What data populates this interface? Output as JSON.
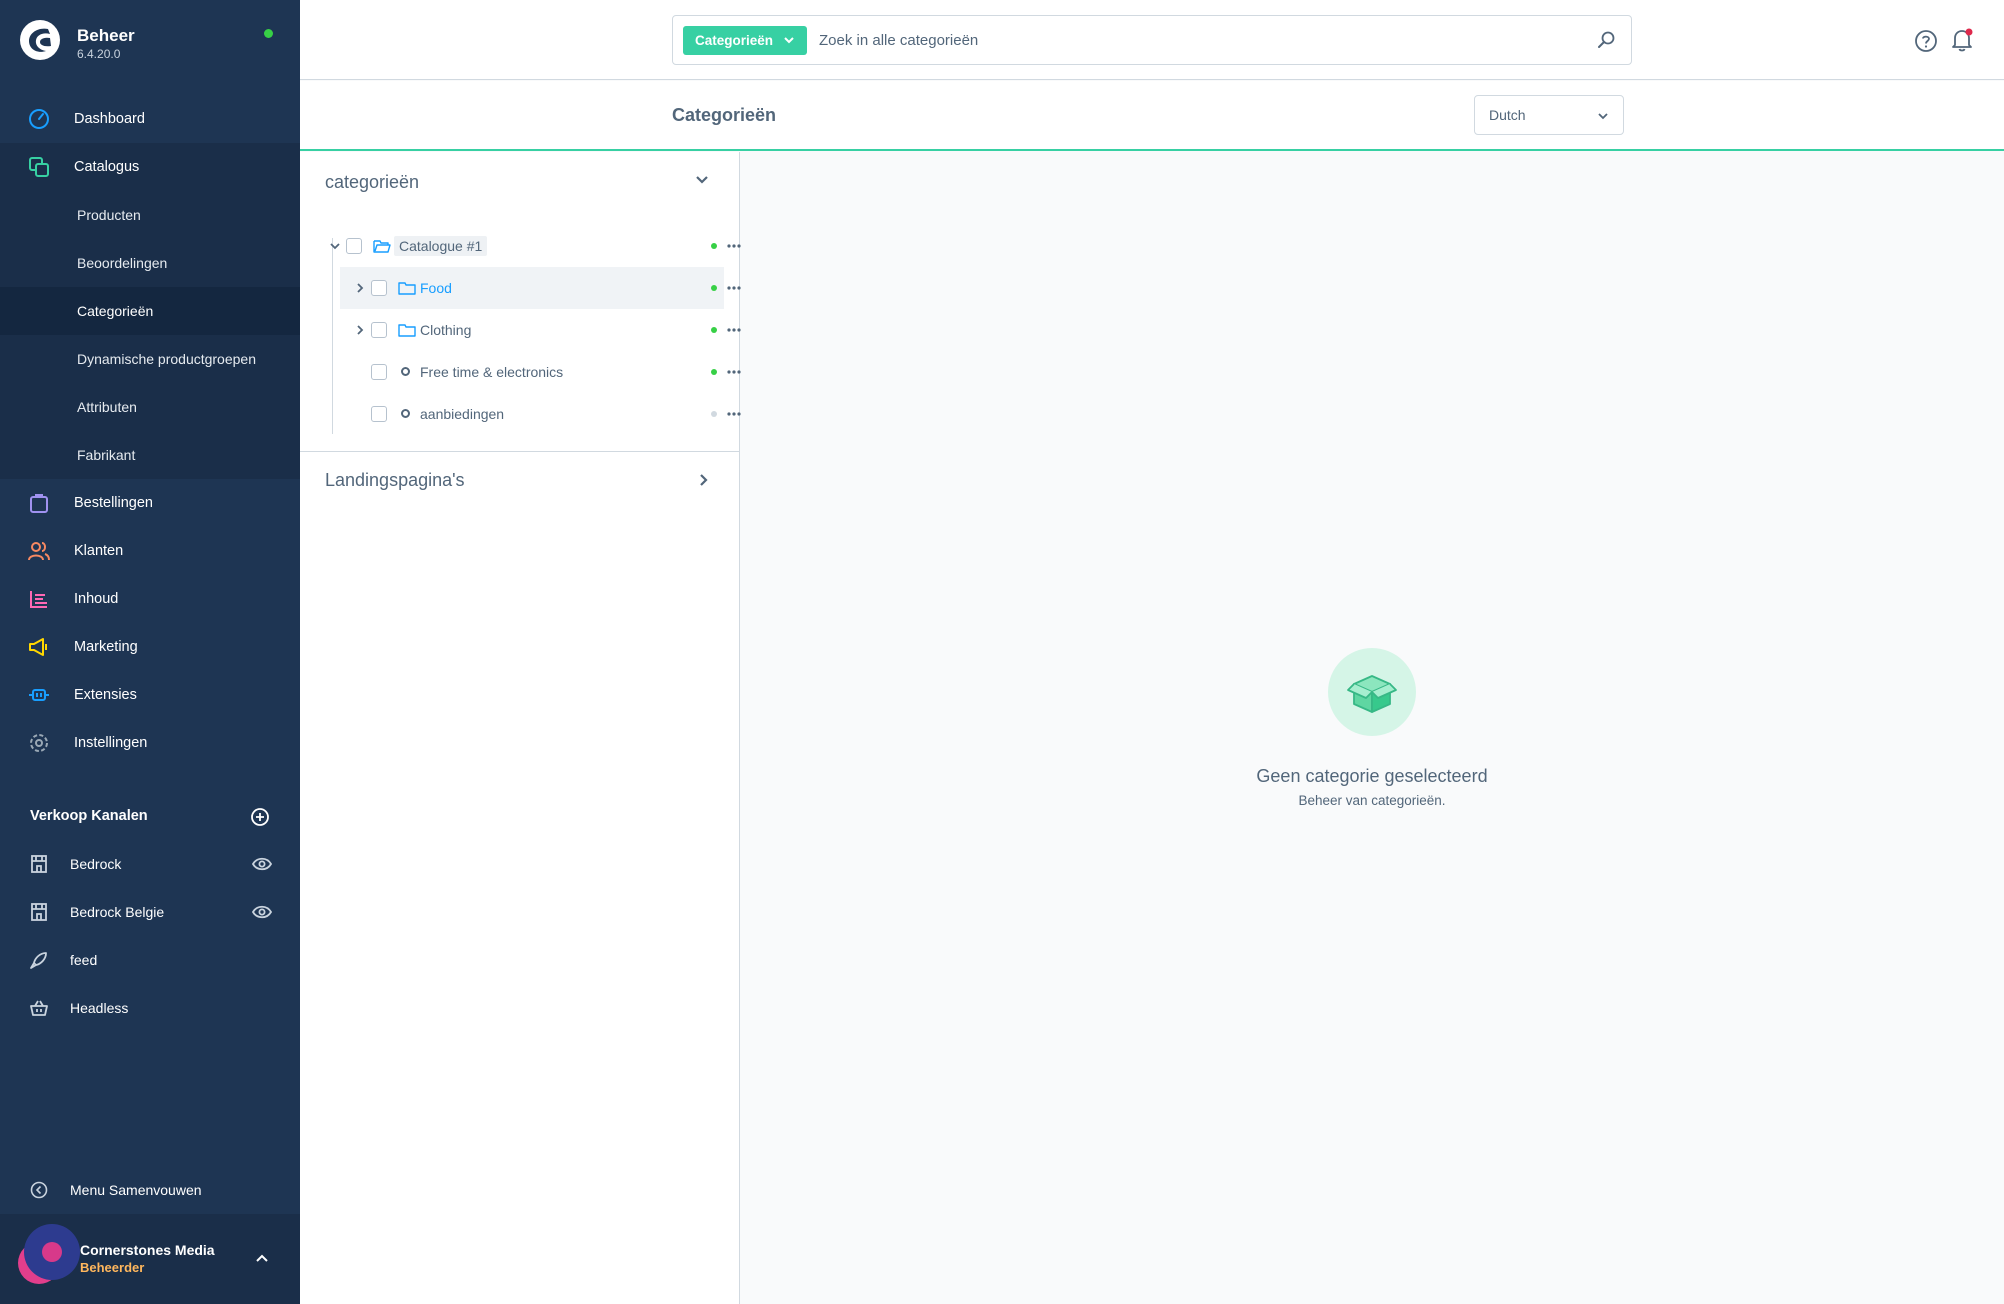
{
  "brand": {
    "name": "Beheer",
    "version": "6.4.20.0"
  },
  "nav": {
    "dashboard": "Dashboard",
    "catalogus": "Catalogus",
    "catalog_sub": [
      "Producten",
      "Beoordelingen",
      "Categorieën",
      "Dynamische productgroepen",
      "Attributen",
      "Fabrikant"
    ],
    "bestellingen": "Bestellingen",
    "klanten": "Klanten",
    "inhoud": "Inhoud",
    "marketing": "Marketing",
    "extensies": "Extensies",
    "instellingen": "Instellingen"
  },
  "channels": {
    "title": "Verkoop Kanalen",
    "items": [
      "Bedrock",
      "Bedrock Belgie",
      "feed",
      "Headless"
    ]
  },
  "collapse_label": "Menu Samenvouwen",
  "user": {
    "name": "Cornerstones Media",
    "role": "Beheerder"
  },
  "search": {
    "type_label": "Categorieën",
    "placeholder": "Zoek in alle categorieën"
  },
  "page": {
    "title": "Categorieën",
    "language": "Dutch"
  },
  "tree": {
    "title": "categorieën",
    "root": "Catalogue #1",
    "children": [
      "Food",
      "Clothing",
      "Free time & electronics",
      "aanbiedingen"
    ]
  },
  "landing": {
    "title": "Landingspagina's"
  },
  "empty": {
    "title": "Geen categorie geselecteerd",
    "subtitle": "Beheer van categorieën."
  },
  "colors": {
    "accent": "#37d0a3",
    "sidebar": "#1e3553",
    "active_dot": "#37d046",
    "inactive_dot": "#d1d9e0",
    "link": "#189eff"
  }
}
